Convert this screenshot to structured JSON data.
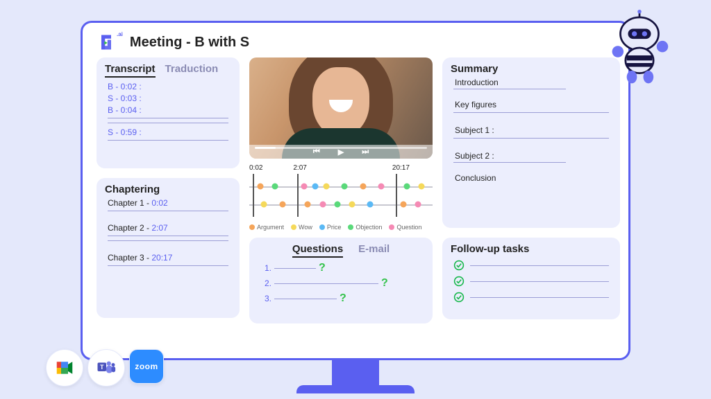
{
  "header": {
    "title": "Meeting - B with S",
    "logo_ai": ".ai"
  },
  "transcript": {
    "tabs": {
      "active": "Transcript",
      "other": "Traduction"
    },
    "rows": [
      "B - 0:02 :",
      "S - 0:03 :",
      "B - 0:04 :",
      "S - 0:59 :"
    ]
  },
  "chaptering": {
    "title": "Chaptering",
    "rows": [
      {
        "label": "Chapter 1 - ",
        "time": "0:02"
      },
      {
        "label": "Chapter 2 - ",
        "time": "2:07"
      },
      {
        "label": "Chapter 3 - ",
        "time": "20:17"
      }
    ]
  },
  "timeline": {
    "labels": [
      "0:02",
      "2:07",
      "20:17"
    ],
    "legend": [
      {
        "name": "Argument",
        "color": "#f5a55a"
      },
      {
        "name": "Wow",
        "color": "#f5d95a"
      },
      {
        "name": "Price",
        "color": "#5ab9f5"
      },
      {
        "name": "Objection",
        "color": "#5ad97a"
      },
      {
        "name": "Question",
        "color": "#f58ab4"
      }
    ]
  },
  "questions": {
    "tabs": {
      "active": "Questions",
      "other": "E-mail"
    },
    "items": [
      "1.",
      "2.",
      "3."
    ]
  },
  "summary": {
    "title": "Summary",
    "rows": [
      "Introduction",
      "Key figures",
      "Subject 1 :",
      "Subject 2 :",
      "Conclusion"
    ]
  },
  "follow": {
    "title": "Follow-up tasks",
    "count": 3
  },
  "integrations": [
    "google-meet",
    "ms-teams",
    "zoom"
  ]
}
